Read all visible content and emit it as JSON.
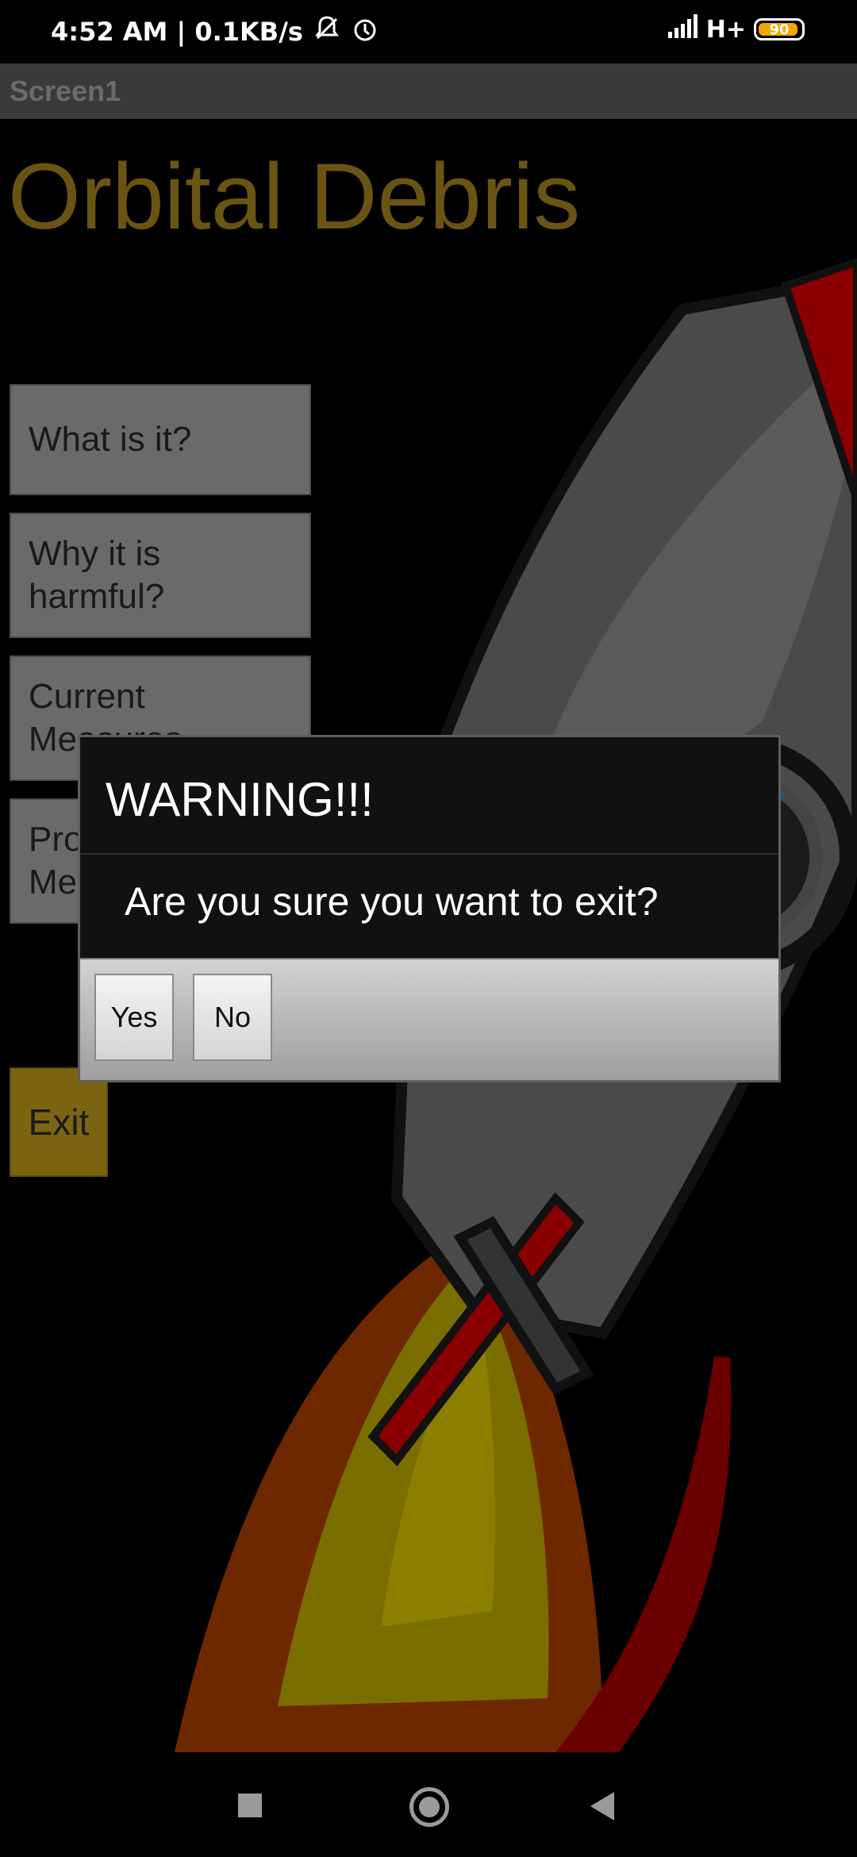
{
  "status_bar": {
    "time_speed": "4:52 AM | 0.1KB/s",
    "network": "H+",
    "battery": "90",
    "icons": [
      "mute-bell-icon",
      "alarm-icon",
      "signal-icon",
      "battery-icon"
    ]
  },
  "app_bar": {
    "title": "Screen1"
  },
  "main": {
    "heading": "Orbital Debris",
    "buttons": [
      {
        "label": "What is it?"
      },
      {
        "label": "Why it is harmful?"
      },
      {
        "label": "Current Measures"
      },
      {
        "label": "Proposed Methods"
      }
    ],
    "exit_label": "Exit"
  },
  "dialog": {
    "title": "WARNING!!!",
    "message": "Are you sure you want to exit?",
    "yes_label": "Yes",
    "no_label": "No"
  },
  "nav": {
    "icons": [
      "recent-apps-icon",
      "home-icon",
      "back-icon"
    ]
  },
  "colors": {
    "heading": "#6a5413",
    "exit_button": "#7d6410",
    "battery": "#f0a500",
    "rocket_red": "#a00000"
  }
}
